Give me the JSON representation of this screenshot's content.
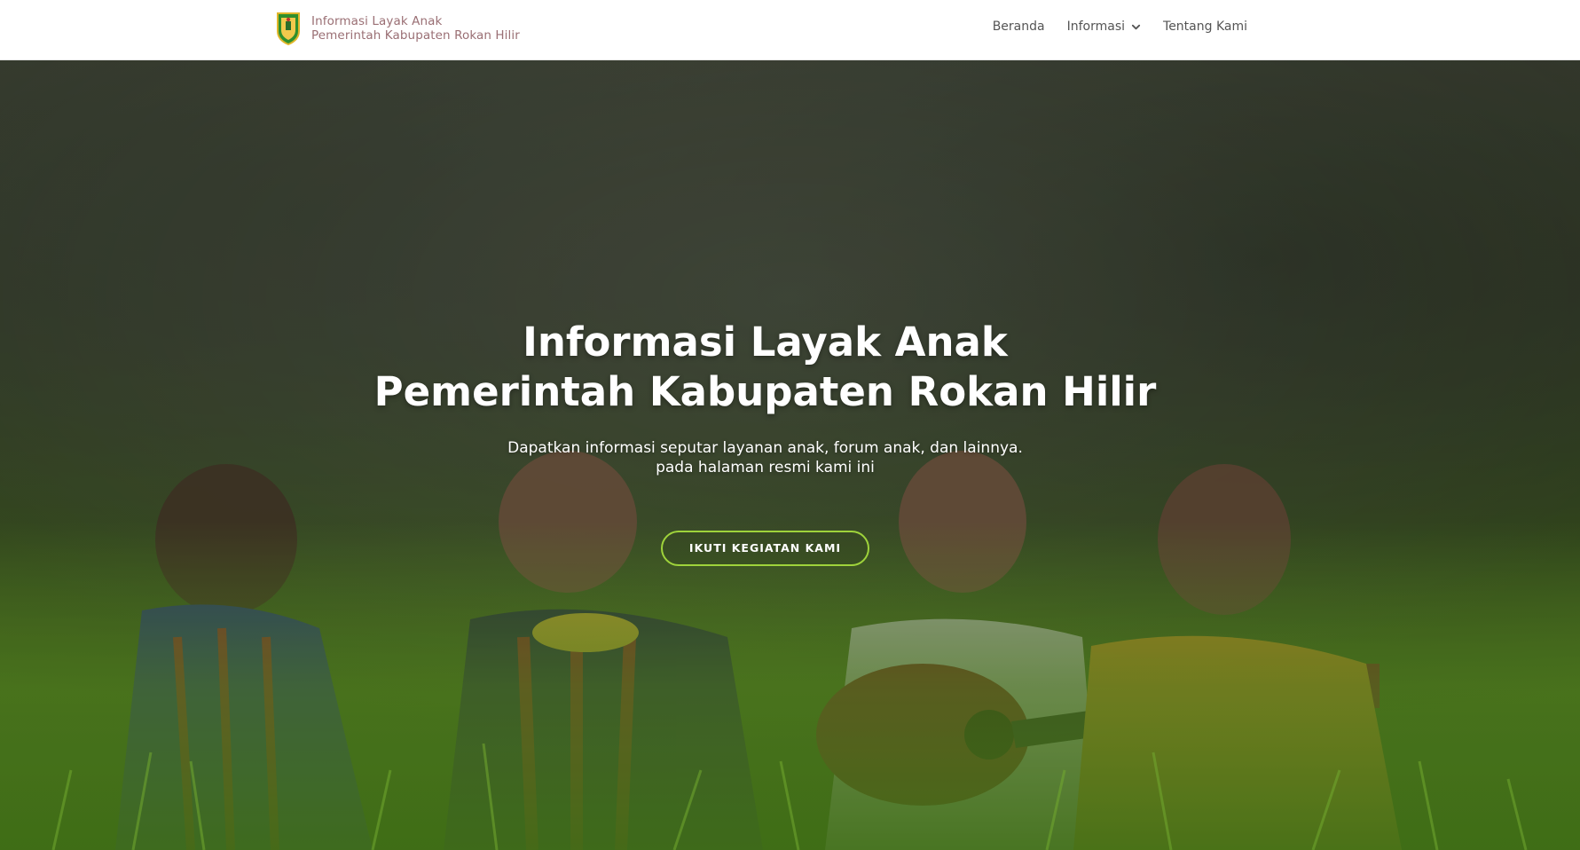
{
  "header": {
    "brand_line1": "Informasi Layak Anak",
    "brand_line2": "Pemerintah Kabupaten Rokan Hilir",
    "logo_icon": "regency-crest-icon"
  },
  "nav": {
    "items": [
      {
        "label": "Beranda"
      },
      {
        "label": "Informasi",
        "has_dropdown": true
      },
      {
        "label": "Tentang Kami"
      }
    ]
  },
  "hero": {
    "title_line1": "Informasi Layak Anak",
    "title_line2": "Pemerintah Kabupaten Rokan Hilir",
    "subtitle_line1": "Dapatkan informasi seputar layanan anak, forum anak, dan lainnya.",
    "subtitle_line2": "pada halaman resmi kami ini",
    "cta_label": "IKUTI KEGIATAN KAMI"
  },
  "colors": {
    "brand_text": "#9a6f74",
    "nav_text": "#555555",
    "cta_border": "#9fd33b"
  }
}
